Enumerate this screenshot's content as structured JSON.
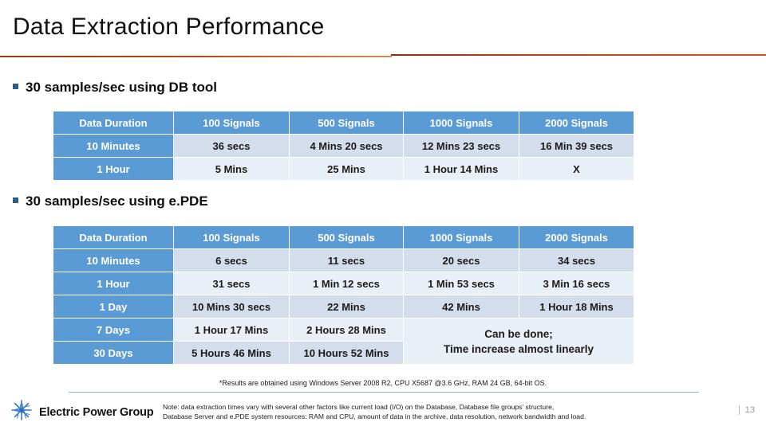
{
  "slide": {
    "title": "Data Extraction Performance",
    "page_number": "13"
  },
  "bullets": [
    {
      "text": "30 samples/sec using DB tool"
    },
    {
      "text": "30 samples/sec using e.PDE"
    }
  ],
  "tables": [
    {
      "id": "db-tool",
      "headers": [
        "Data Duration",
        "100 Signals",
        "500 Signals",
        "1000 Signals",
        "2000 Signals"
      ],
      "rows": [
        {
          "label": "10 Minutes",
          "cells": [
            "36 secs",
            "4 Mins 20 secs",
            "12 Mins 23 secs",
            "16 Min 39 secs"
          ]
        },
        {
          "label": "1 Hour",
          "cells": [
            "5 Mins",
            "25 Mins",
            "1 Hour 14 Mins",
            "X"
          ]
        }
      ]
    },
    {
      "id": "epde",
      "headers": [
        "Data Duration",
        "100 Signals",
        "500 Signals",
        "1000 Signals",
        "2000 Signals"
      ],
      "rows": [
        {
          "label": "10 Minutes",
          "cells": [
            "6 secs",
            "11 secs",
            "20 secs",
            "34 secs"
          ]
        },
        {
          "label": "1 Hour",
          "cells": [
            "31 secs",
            "1 Min 12 secs",
            "1 Min 53 secs",
            "3 Min 16 secs"
          ]
        },
        {
          "label": "1 Day",
          "cells": [
            "10 Mins 30 secs",
            "22 Mins",
            "42 Mins",
            "1 Hour 18 Mins"
          ]
        },
        {
          "label": "7 Days",
          "cells": [
            "1 Hour 17 Mins",
            "2 Hours 28 Mins"
          ]
        },
        {
          "label": "30 Days",
          "cells": [
            "5 Hours 46 Mins",
            "10 Hours 52 Mins"
          ]
        }
      ],
      "merged_cell": {
        "line1": "Can be done;",
        "line2": "Time increase almost linearly"
      }
    }
  ],
  "footnote": "*Results are obtained using Windows Server 2008 R2, CPU X5687 @3.6 GHz, RAM 24 GB, 64-bit OS.",
  "footer": {
    "logo_text": "Electric Power Group",
    "note_line1": "Note: data extraction times vary with several other factors like current load (I/O) on the Database, Database file groups’ structure,",
    "note_line2": "Database Server and e.PDE system resources: RAM and CPU, amount of data in the archive, data resolution, network bandwidth and load."
  },
  "colors": {
    "header_blue": "#5b9bd5",
    "band_dark": "#d3ddeb",
    "band_light": "#e9eff7",
    "rule_red": "#b8431a",
    "logo_blue": "#2b6cb8"
  }
}
